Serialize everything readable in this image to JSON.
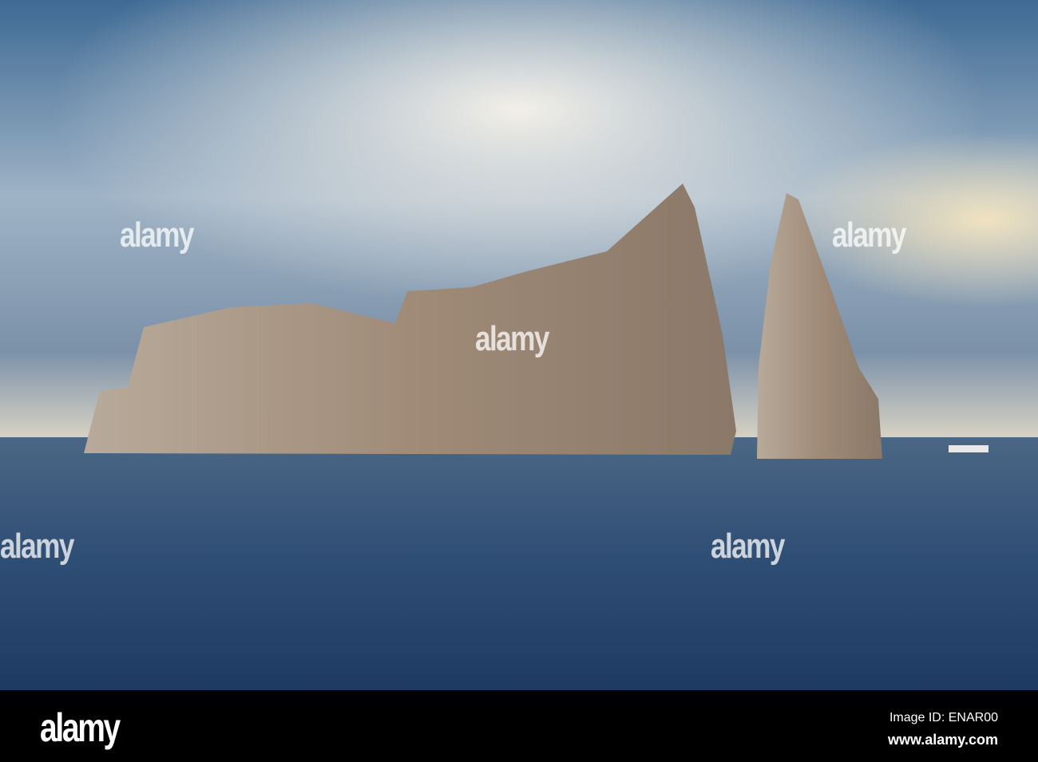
{
  "watermark": {
    "text": "alamy"
  },
  "footer": {
    "logo": "alamy",
    "image_id": "Image ID: ENAR00",
    "url": "www.alamy.com"
  }
}
